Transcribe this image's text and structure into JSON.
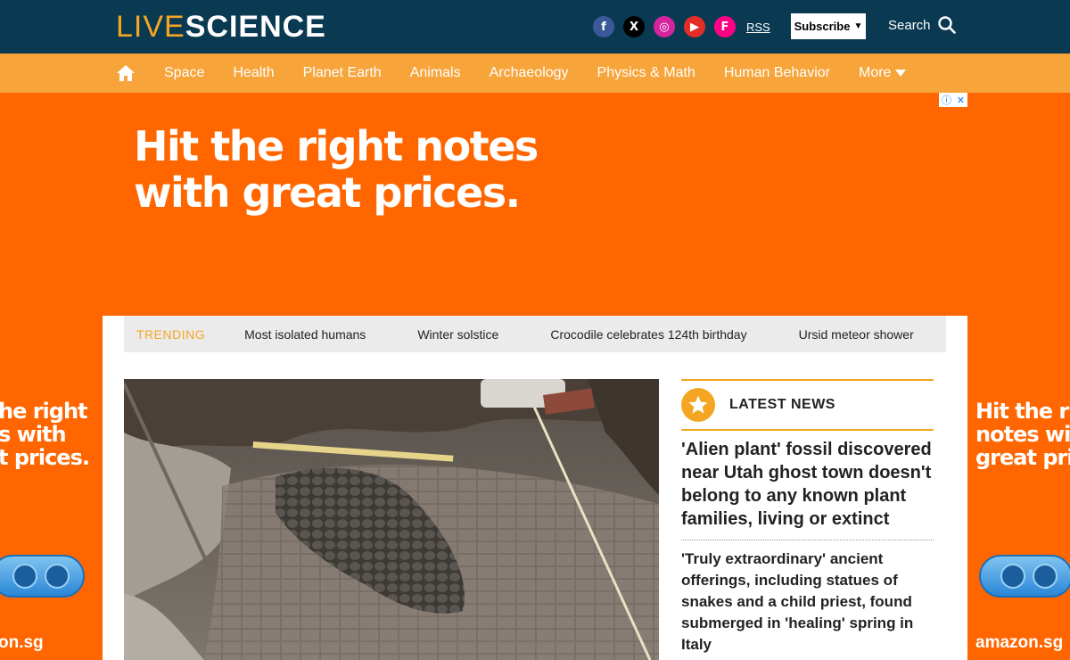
{
  "header": {
    "logo_live": "LIVE",
    "logo_science": "SCIENCE",
    "social": {
      "facebook": "f",
      "x": "X",
      "instagram": "◎",
      "youtube": "▶",
      "flipboard": "F"
    },
    "rss": "RSS",
    "subscribe": "Subscribe",
    "subscribe_caret": "▼",
    "search": "Search"
  },
  "nav": {
    "items": [
      "Space",
      "Health",
      "Planet Earth",
      "Animals",
      "Archaeology",
      "Physics & Math",
      "Human Behavior"
    ],
    "more": "More"
  },
  "ad": {
    "headline_line1": "Hit the right notes",
    "headline_line2": "with great prices.",
    "choices_info": "ⓘ",
    "choices_close": "✕",
    "left_line1": "he right",
    "left_line2": "s with",
    "left_line3": "t prices.",
    "left_brand": "on.sg",
    "right_line1": "Hit the rig",
    "right_line2": "notes wit",
    "right_line3": "great pric",
    "right_brand": "amazon.sg"
  },
  "trending": {
    "label": "TRENDING",
    "items": [
      "Most isolated humans",
      "Winter solstice",
      "Crocodile celebrates 124th birthday",
      "Ursid meteor shower"
    ]
  },
  "latest": {
    "title": "LATEST NEWS",
    "articles": [
      "'Alien plant' fossil discovered near Utah ghost town doesn't belong to any known plant families, living or extinct",
      "'Truly extraordinary' ancient offerings, including statues of snakes and a child priest, found submerged in 'healing' spring in Italy"
    ]
  },
  "colors": {
    "header_bg": "#0a3a52",
    "nav_bg": "#f7a43a",
    "accent": "#f4a623",
    "ad_orange": "#ff6600"
  }
}
